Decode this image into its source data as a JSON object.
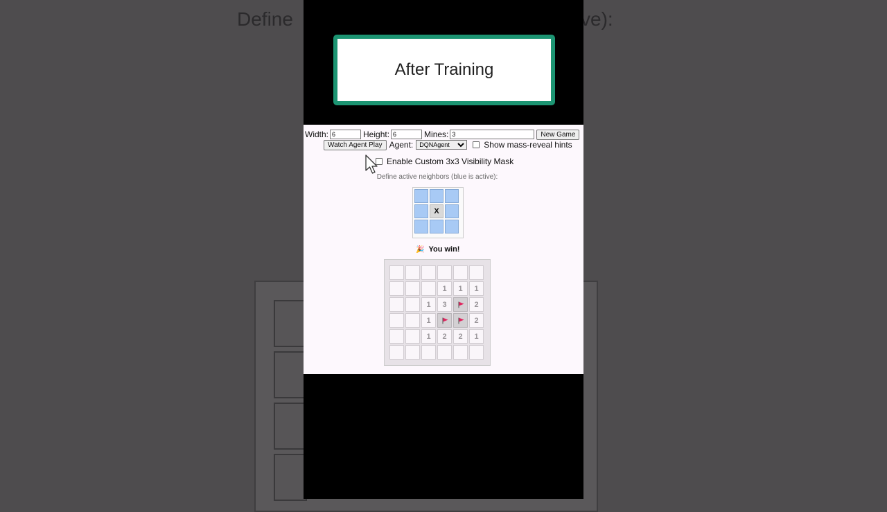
{
  "background": {
    "ghost_left": "Define",
    "ghost_right": "ve):"
  },
  "banner": {
    "title": "After Training"
  },
  "controls": {
    "width_label": "Width:",
    "width_value": "6",
    "height_label": "Height:",
    "height_value": "6",
    "mines_label": "Mines:",
    "mines_value": "3",
    "new_game_label": "New Game",
    "watch_label": "Watch Agent Play",
    "agent_label": "Agent:",
    "agent_selected": "DQNAgent",
    "mass_reveal_label": "Show mass-reveal hints"
  },
  "mask": {
    "enable_label": "Enable Custom 3x3 Visibility Mask",
    "hint": "Define active neighbors (blue is active):",
    "center_label": "X",
    "active_color": "#a8caf5"
  },
  "status": {
    "message": "You win!",
    "icon": "party-popper-icon"
  },
  "board": {
    "rows": 6,
    "cols": 6,
    "cells": [
      [
        "",
        "",
        "",
        "",
        "",
        ""
      ],
      [
        "",
        "",
        "",
        "1",
        "1",
        "1"
      ],
      [
        "",
        "",
        "1",
        "3",
        "F",
        "2"
      ],
      [
        "",
        "",
        "1",
        "F",
        "F",
        "2"
      ],
      [
        "",
        "",
        "1",
        "2",
        "2",
        "1"
      ],
      [
        "",
        "",
        "",
        "",
        "",
        ""
      ]
    ],
    "flag_color": "#e0245e"
  }
}
